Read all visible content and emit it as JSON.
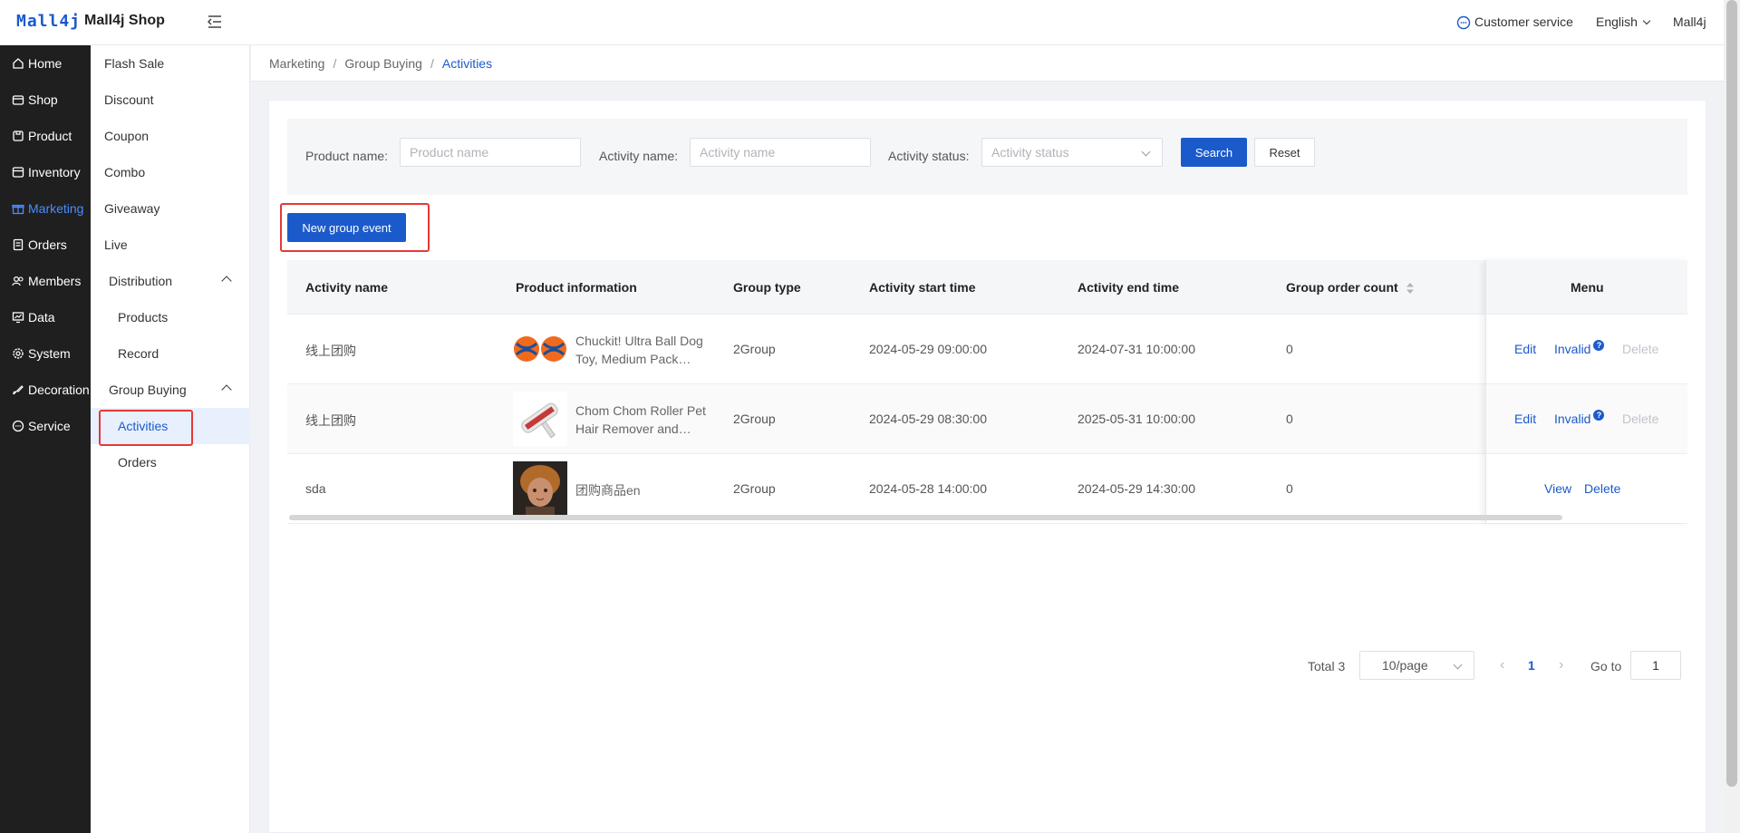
{
  "header": {
    "logo_text": "Mall4j",
    "shop_name": "Mall4j Shop",
    "customer_service": "Customer service",
    "language": "English",
    "user": "Mall4j"
  },
  "sidebar": {
    "items": [
      {
        "label": "Home",
        "icon": "home-icon"
      },
      {
        "label": "Shop",
        "icon": "shop-icon"
      },
      {
        "label": "Product",
        "icon": "product-icon"
      },
      {
        "label": "Inventory",
        "icon": "inventory-icon"
      },
      {
        "label": "Marketing",
        "icon": "gift-icon"
      },
      {
        "label": "Orders",
        "icon": "orders-icon"
      },
      {
        "label": "Members",
        "icon": "members-icon"
      },
      {
        "label": "Data",
        "icon": "chart-icon"
      },
      {
        "label": "System",
        "icon": "gear-icon"
      },
      {
        "label": "Decoration",
        "icon": "decoration-icon"
      },
      {
        "label": "Service",
        "icon": "chat-icon"
      }
    ],
    "active": "Marketing"
  },
  "subsidebar": {
    "items": [
      "Flash Sale",
      "Discount",
      "Coupon",
      "Combo",
      "Giveaway",
      "Live"
    ],
    "distribution": {
      "label": "Distribution",
      "children": [
        "Products",
        "Record"
      ]
    },
    "group_buying": {
      "label": "Group Buying",
      "children": [
        "Activities",
        "Orders"
      ]
    },
    "active": "Activities"
  },
  "breadcrumb": [
    "Marketing",
    "Group Buying",
    "Activities"
  ],
  "filter": {
    "product_name_label": "Product name:",
    "product_name_placeholder": "Product name",
    "activity_name_label": "Activity name:",
    "activity_name_placeholder": "Activity name",
    "activity_status_label": "Activity status:",
    "activity_status_placeholder": "Activity status",
    "search_label": "Search",
    "reset_label": "Reset"
  },
  "new_event_label": "New group event",
  "table": {
    "columns": [
      "Activity name",
      "Product information",
      "Group type",
      "Activity start time",
      "Activity end time",
      "Group order count",
      "Menu"
    ],
    "rows": [
      {
        "activity_name": "线上团购",
        "product": "Chuckit! Ultra Ball Dog Toy, Medium Pack…",
        "thumb": "ball-thumb",
        "group_type": "2Group",
        "start": "2024-05-29 09:00:00",
        "end": "2024-07-31 10:00:00",
        "count": "0",
        "actions": [
          "Edit",
          "Invalid",
          "Delete"
        ]
      },
      {
        "activity_name": "线上团购",
        "product": "Chom Chom Roller Pet Hair Remover and…",
        "thumb": "roller-thumb",
        "group_type": "2Group",
        "start": "2024-05-29 08:30:00",
        "end": "2025-05-31 10:00:00",
        "count": "0",
        "actions": [
          "Edit",
          "Invalid",
          "Delete"
        ]
      },
      {
        "activity_name": "sda",
        "product": "团购商品en",
        "thumb": "portrait-thumb",
        "group_type": "2Group",
        "start": "2024-05-28 14:00:00",
        "end": "2024-05-29 14:30:00",
        "count": "0",
        "actions": [
          "View",
          "Delete"
        ]
      }
    ]
  },
  "pagination": {
    "total": "Total 3",
    "page_size": "10/page",
    "current_page": "1",
    "goto_label": "Go to",
    "goto_value": "1"
  },
  "colors": {
    "accent": "#1b5acb",
    "sidebar_bg": "#1f1f1f",
    "highlight": "#e53935"
  }
}
